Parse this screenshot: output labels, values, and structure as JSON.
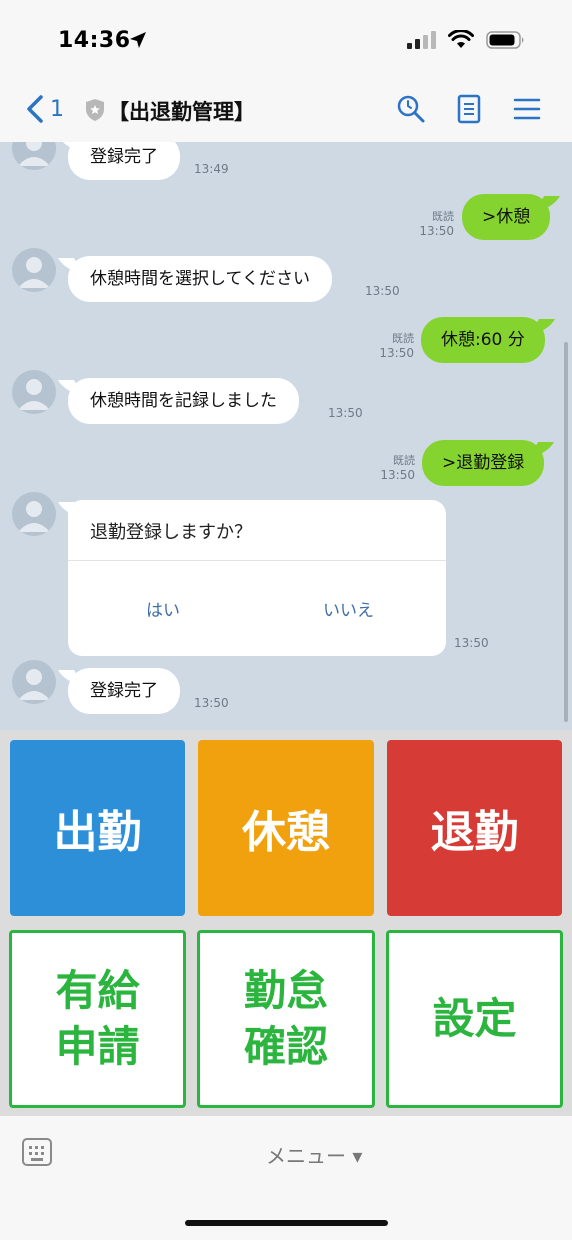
{
  "status_bar": {
    "time": "14:36"
  },
  "nav": {
    "back_count": "1",
    "title": "【出退勤管理】"
  },
  "messages": [
    {
      "text": "登録完了",
      "time": "13:49"
    },
    {
      "text": ">休憩",
      "time": "13:50",
      "read": "既読"
    },
    {
      "text": "休憩時間を選択してください",
      "time": "13:50"
    },
    {
      "text": "休憩:60 分",
      "time": "13:50",
      "read": "既読"
    },
    {
      "text": "休憩時間を記録しました",
      "time": "13:50"
    },
    {
      "text": ">退勤登録",
      "time": "13:50",
      "read": "既読"
    },
    {
      "text": "登録完了",
      "time": "13:50"
    }
  ],
  "confirm_card": {
    "question": "退勤登録しますか？",
    "yes": "はい",
    "no": "いいえ",
    "time": "13:50"
  },
  "rich_menu": {
    "clock_in": "出勤",
    "break": "休憩",
    "clock_out": "退勤",
    "paid_leave_1": "有給",
    "paid_leave_2": "申請",
    "attendance_1": "勤怠",
    "attendance_2": "確認",
    "settings": "設定"
  },
  "colors": {
    "clock_in": "#2e8fd9",
    "break": "#f2a10e",
    "clock_out": "#d63c35",
    "outline_green": "#2bb43e",
    "bubble_green": "#84d32f",
    "chat_bg": "#cfd9e3"
  },
  "bottom_bar": {
    "menu_label": "メニュー ▾"
  }
}
